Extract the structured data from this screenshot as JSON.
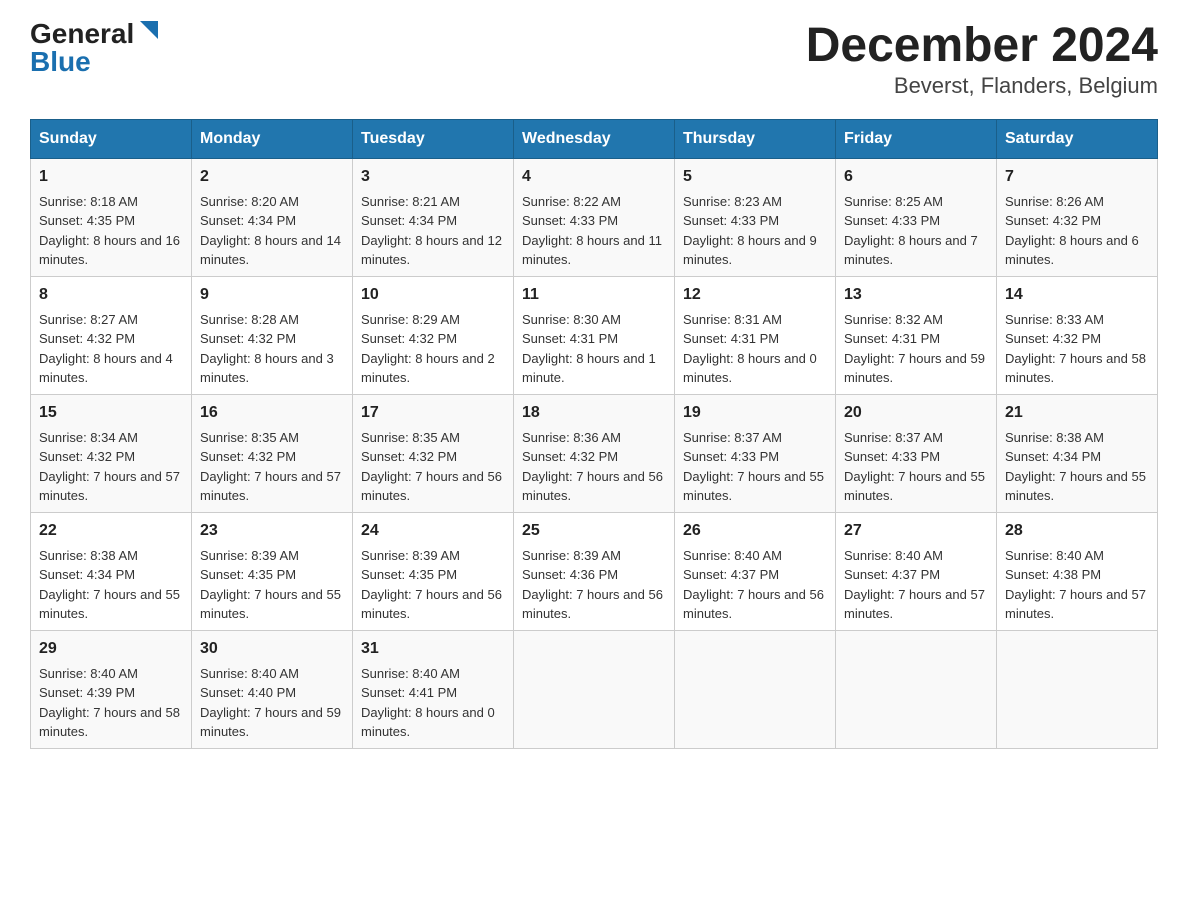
{
  "header": {
    "logo_general": "General",
    "logo_blue": "Blue",
    "title": "December 2024",
    "subtitle": "Beverst, Flanders, Belgium"
  },
  "days_of_week": [
    "Sunday",
    "Monday",
    "Tuesday",
    "Wednesday",
    "Thursday",
    "Friday",
    "Saturday"
  ],
  "weeks": [
    [
      {
        "day": "1",
        "sunrise": "Sunrise: 8:18 AM",
        "sunset": "Sunset: 4:35 PM",
        "daylight": "Daylight: 8 hours and 16 minutes."
      },
      {
        "day": "2",
        "sunrise": "Sunrise: 8:20 AM",
        "sunset": "Sunset: 4:34 PM",
        "daylight": "Daylight: 8 hours and 14 minutes."
      },
      {
        "day": "3",
        "sunrise": "Sunrise: 8:21 AM",
        "sunset": "Sunset: 4:34 PM",
        "daylight": "Daylight: 8 hours and 12 minutes."
      },
      {
        "day": "4",
        "sunrise": "Sunrise: 8:22 AM",
        "sunset": "Sunset: 4:33 PM",
        "daylight": "Daylight: 8 hours and 11 minutes."
      },
      {
        "day": "5",
        "sunrise": "Sunrise: 8:23 AM",
        "sunset": "Sunset: 4:33 PM",
        "daylight": "Daylight: 8 hours and 9 minutes."
      },
      {
        "day": "6",
        "sunrise": "Sunrise: 8:25 AM",
        "sunset": "Sunset: 4:33 PM",
        "daylight": "Daylight: 8 hours and 7 minutes."
      },
      {
        "day": "7",
        "sunrise": "Sunrise: 8:26 AM",
        "sunset": "Sunset: 4:32 PM",
        "daylight": "Daylight: 8 hours and 6 minutes."
      }
    ],
    [
      {
        "day": "8",
        "sunrise": "Sunrise: 8:27 AM",
        "sunset": "Sunset: 4:32 PM",
        "daylight": "Daylight: 8 hours and 4 minutes."
      },
      {
        "day": "9",
        "sunrise": "Sunrise: 8:28 AM",
        "sunset": "Sunset: 4:32 PM",
        "daylight": "Daylight: 8 hours and 3 minutes."
      },
      {
        "day": "10",
        "sunrise": "Sunrise: 8:29 AM",
        "sunset": "Sunset: 4:32 PM",
        "daylight": "Daylight: 8 hours and 2 minutes."
      },
      {
        "day": "11",
        "sunrise": "Sunrise: 8:30 AM",
        "sunset": "Sunset: 4:31 PM",
        "daylight": "Daylight: 8 hours and 1 minute."
      },
      {
        "day": "12",
        "sunrise": "Sunrise: 8:31 AM",
        "sunset": "Sunset: 4:31 PM",
        "daylight": "Daylight: 8 hours and 0 minutes."
      },
      {
        "day": "13",
        "sunrise": "Sunrise: 8:32 AM",
        "sunset": "Sunset: 4:31 PM",
        "daylight": "Daylight: 7 hours and 59 minutes."
      },
      {
        "day": "14",
        "sunrise": "Sunrise: 8:33 AM",
        "sunset": "Sunset: 4:32 PM",
        "daylight": "Daylight: 7 hours and 58 minutes."
      }
    ],
    [
      {
        "day": "15",
        "sunrise": "Sunrise: 8:34 AM",
        "sunset": "Sunset: 4:32 PM",
        "daylight": "Daylight: 7 hours and 57 minutes."
      },
      {
        "day": "16",
        "sunrise": "Sunrise: 8:35 AM",
        "sunset": "Sunset: 4:32 PM",
        "daylight": "Daylight: 7 hours and 57 minutes."
      },
      {
        "day": "17",
        "sunrise": "Sunrise: 8:35 AM",
        "sunset": "Sunset: 4:32 PM",
        "daylight": "Daylight: 7 hours and 56 minutes."
      },
      {
        "day": "18",
        "sunrise": "Sunrise: 8:36 AM",
        "sunset": "Sunset: 4:32 PM",
        "daylight": "Daylight: 7 hours and 56 minutes."
      },
      {
        "day": "19",
        "sunrise": "Sunrise: 8:37 AM",
        "sunset": "Sunset: 4:33 PM",
        "daylight": "Daylight: 7 hours and 55 minutes."
      },
      {
        "day": "20",
        "sunrise": "Sunrise: 8:37 AM",
        "sunset": "Sunset: 4:33 PM",
        "daylight": "Daylight: 7 hours and 55 minutes."
      },
      {
        "day": "21",
        "sunrise": "Sunrise: 8:38 AM",
        "sunset": "Sunset: 4:34 PM",
        "daylight": "Daylight: 7 hours and 55 minutes."
      }
    ],
    [
      {
        "day": "22",
        "sunrise": "Sunrise: 8:38 AM",
        "sunset": "Sunset: 4:34 PM",
        "daylight": "Daylight: 7 hours and 55 minutes."
      },
      {
        "day": "23",
        "sunrise": "Sunrise: 8:39 AM",
        "sunset": "Sunset: 4:35 PM",
        "daylight": "Daylight: 7 hours and 55 minutes."
      },
      {
        "day": "24",
        "sunrise": "Sunrise: 8:39 AM",
        "sunset": "Sunset: 4:35 PM",
        "daylight": "Daylight: 7 hours and 56 minutes."
      },
      {
        "day": "25",
        "sunrise": "Sunrise: 8:39 AM",
        "sunset": "Sunset: 4:36 PM",
        "daylight": "Daylight: 7 hours and 56 minutes."
      },
      {
        "day": "26",
        "sunrise": "Sunrise: 8:40 AM",
        "sunset": "Sunset: 4:37 PM",
        "daylight": "Daylight: 7 hours and 56 minutes."
      },
      {
        "day": "27",
        "sunrise": "Sunrise: 8:40 AM",
        "sunset": "Sunset: 4:37 PM",
        "daylight": "Daylight: 7 hours and 57 minutes."
      },
      {
        "day": "28",
        "sunrise": "Sunrise: 8:40 AM",
        "sunset": "Sunset: 4:38 PM",
        "daylight": "Daylight: 7 hours and 57 minutes."
      }
    ],
    [
      {
        "day": "29",
        "sunrise": "Sunrise: 8:40 AM",
        "sunset": "Sunset: 4:39 PM",
        "daylight": "Daylight: 7 hours and 58 minutes."
      },
      {
        "day": "30",
        "sunrise": "Sunrise: 8:40 AM",
        "sunset": "Sunset: 4:40 PM",
        "daylight": "Daylight: 7 hours and 59 minutes."
      },
      {
        "day": "31",
        "sunrise": "Sunrise: 8:40 AM",
        "sunset": "Sunset: 4:41 PM",
        "daylight": "Daylight: 8 hours and 0 minutes."
      },
      null,
      null,
      null,
      null
    ]
  ]
}
